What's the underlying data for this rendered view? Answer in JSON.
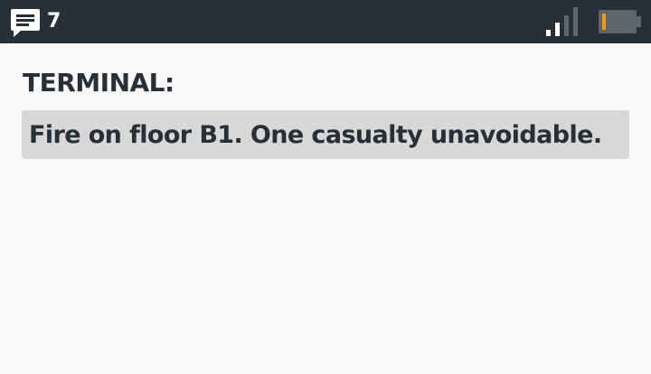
{
  "status_bar": {
    "message_icon": "message-bubble-icon",
    "message_count": "7",
    "signal_icon": "signal-strength-icon",
    "battery_icon": "battery-icon",
    "battery_level": 0.12,
    "battery_color": "#f39c12",
    "background_color": "#263036"
  },
  "terminal": {
    "label": "TERMINAL:",
    "message": "Fire on floor B1. One casualty unavoidable."
  }
}
